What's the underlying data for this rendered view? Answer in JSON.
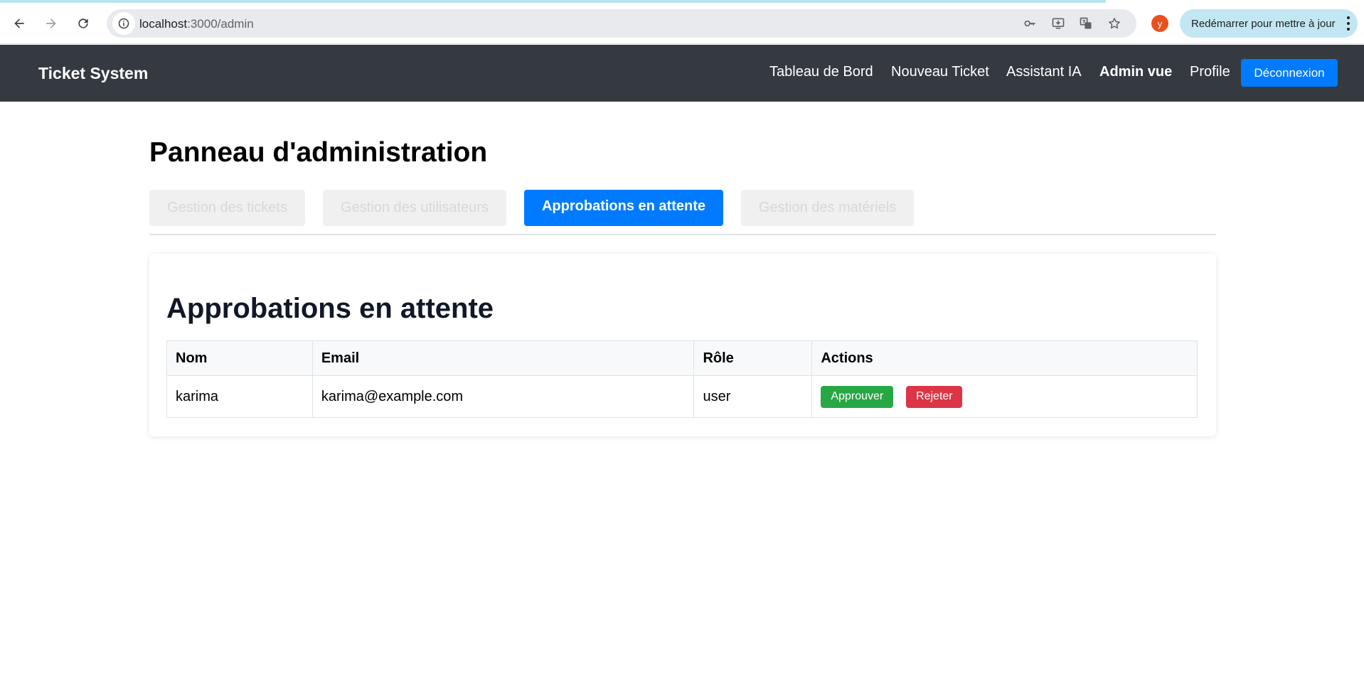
{
  "browser": {
    "url_host": "localhost",
    "url_path": ":3000/admin",
    "profile_initial": "y",
    "restart_label": "Redémarrer pour mettre à jour"
  },
  "navbar": {
    "brand": "Ticket System",
    "links": [
      {
        "label": "Tableau de Bord"
      },
      {
        "label": "Nouveau Ticket"
      },
      {
        "label": "Assistant IA"
      },
      {
        "label": "Admin vue"
      },
      {
        "label": "Profile"
      }
    ],
    "logout_label": "Déconnexion"
  },
  "page": {
    "title": "Panneau d'administration",
    "tabs": [
      {
        "label": "Gestion des tickets"
      },
      {
        "label": "Gestion des utilisateurs"
      },
      {
        "label": "Approbations en attente"
      },
      {
        "label": "Gestion des matériels"
      }
    ]
  },
  "approvals": {
    "title": "Approbations en attente",
    "columns": [
      "Nom",
      "Email",
      "Rôle",
      "Actions"
    ],
    "rows": [
      {
        "name": "karima",
        "email": "karima@example.com",
        "role": "user",
        "approve_label": "Approuver",
        "reject_label": "Rejeter"
      }
    ]
  },
  "colors": {
    "navbar_bg": "#343a40",
    "primary": "#007bff",
    "success": "#28a745",
    "danger": "#dc3545"
  }
}
